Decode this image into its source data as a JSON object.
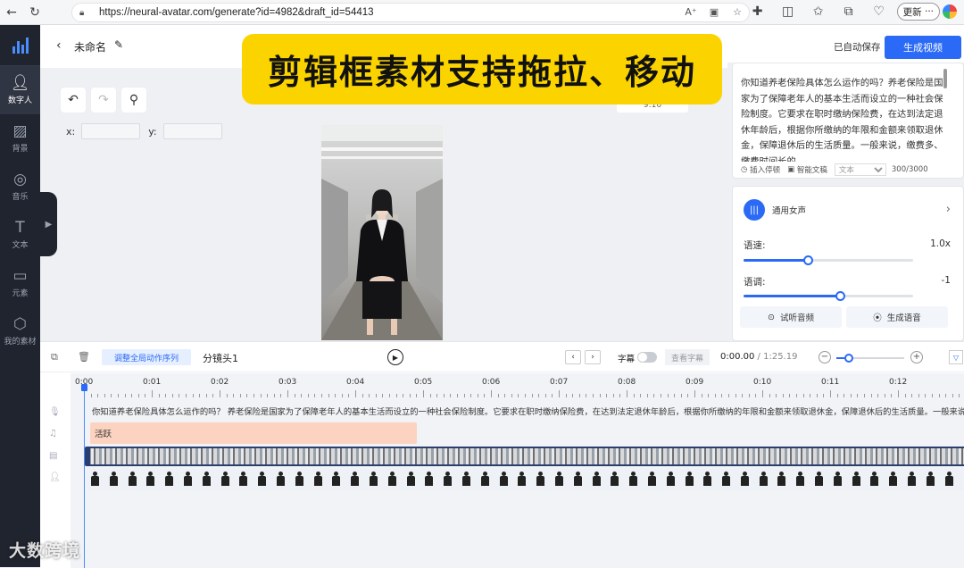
{
  "browser": {
    "url": "https://neural-avatar.com/generate?id=4982&draft_id=54413",
    "update_label": "更新",
    "more_label": "···"
  },
  "sidebar": {
    "items": [
      {
        "label": "数字人",
        "icon": "person-icon"
      },
      {
        "label": "背景",
        "icon": "background-icon"
      },
      {
        "label": "音乐",
        "icon": "music-icon"
      },
      {
        "label": "文本",
        "icon": "text-icon"
      },
      {
        "label": "元素",
        "icon": "image-icon"
      },
      {
        "label": "我的素材",
        "icon": "cube-icon"
      }
    ]
  },
  "header": {
    "title": "未命名",
    "autosave": "已自动保存",
    "generate_video": "生成视频"
  },
  "banner": {
    "text": "剪辑框素材支持拖拉、移动"
  },
  "canvas": {
    "x_label": "x:",
    "y_label": "y:",
    "x_value": "",
    "y_value": "",
    "zoom_partial": "9:16"
  },
  "script": {
    "text": "你知道养老保险具体怎么运作的吗？养老保险是国家为了保障老年人的基本生活而设立的一种社会保险制度。它要求在职时缴纳保险费，在达到法定退休年龄后，根据你所缴纳的年限和金额来领取退休金，保障退休后的生活质量。一般来说，缴费多、缴费时间长的",
    "insert_pause": "插入停顿",
    "smart_copy": "智能文稿",
    "select_value": "文本",
    "count": "300/3000"
  },
  "voice": {
    "name": "通用女声",
    "speed_label": "语速:",
    "speed_value": "1.0x",
    "speed_fraction": 0.38,
    "pitch_label": "语调:",
    "pitch_value": "-1",
    "pitch_fraction": 0.57,
    "preview_label": "试听音频",
    "generate_label": "生成语音"
  },
  "timeline": {
    "adjust_label": "调整全局动作序列",
    "shot_label": "分镜头1",
    "subtitle_label": "字幕",
    "view_subtitle": "查看字幕",
    "current_time": "0:00.00",
    "total_time": "/ 1:25.19",
    "ruler": [
      "0:00",
      "0:01",
      "0:02",
      "0:03",
      "0:04",
      "0:05",
      "0:06",
      "0:07",
      "0:08",
      "0:09",
      "0:10",
      "0:11",
      "0:12"
    ],
    "subtitle_track": "你知道养老保险具体怎么运作的吗？ 养老保险是国家为了保障老年人的基本生活而设立的一种社会保险制度。它要求在职时缴纳保险费，在达到法定退休年龄后，根据你所缴纳的年限和金额来领取退休金，保障退休后的生活质量。一般来说，缴",
    "action_clip": "活跃",
    "zoom_fraction": 0.12
  },
  "watermark": "大数跨境",
  "colors": {
    "accent": "#2a6af6",
    "sidebar": "#20242e",
    "banner": "#fbd400",
    "action_clip": "#fbd3c0"
  }
}
